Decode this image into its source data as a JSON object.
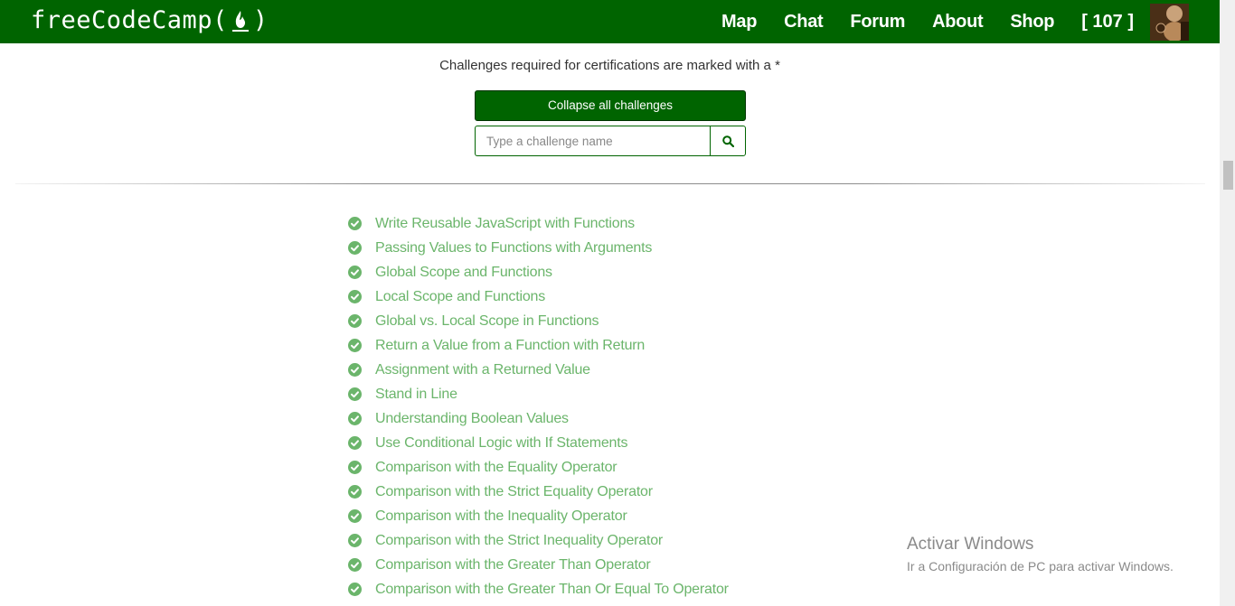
{
  "navbar": {
    "brand_left": "freeCodeCamp(",
    "brand_right": ")",
    "links": [
      "Map",
      "Chat",
      "Forum",
      "About",
      "Shop"
    ],
    "points": "[ 107 ]",
    "background_color": "#006400"
  },
  "main": {
    "notice": "Challenges required for certifications are marked with a *",
    "collapse_label": "Collapse all challenges",
    "search_placeholder": "Type a challenge name",
    "search_icon": "search-icon"
  },
  "challenges": [
    "Write Reusable JavaScript with Functions",
    "Passing Values to Functions with Arguments",
    "Global Scope and Functions",
    "Local Scope and Functions",
    "Global vs. Local Scope in Functions",
    "Return a Value from a Function with Return",
    "Assignment with a Returned Value",
    "Stand in Line",
    "Understanding Boolean Values",
    "Use Conditional Logic with If Statements",
    "Comparison with the Equality Operator",
    "Comparison with the Strict Equality Operator",
    "Comparison with the Inequality Operator",
    "Comparison with the Strict Inequality Operator",
    "Comparison with the Greater Than Operator",
    "Comparison with the Greater Than Or Equal To Operator"
  ],
  "challenge_status_icon": "check-circle-icon",
  "challenge_color": "#6bb56b",
  "windows_watermark": {
    "title": "Activar Windows",
    "subtitle": "Ir a Configuración de PC para activar Windows."
  }
}
